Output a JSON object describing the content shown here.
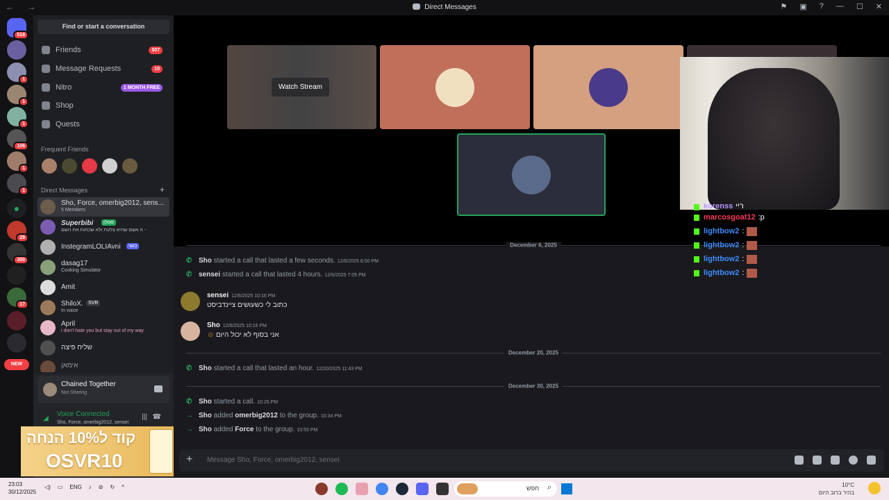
{
  "window": {
    "title": "Direct Messages"
  },
  "sidebar": {
    "find_placeholder": "Find or start a conversation",
    "nav": [
      {
        "label": "Friends",
        "badge": "507"
      },
      {
        "label": "Message Requests",
        "badge": "10"
      },
      {
        "label": "Nitro",
        "badge": "1 MONTH FREE"
      },
      {
        "label": "Shop"
      },
      {
        "label": "Quests"
      }
    ],
    "frequent_friends_label": "Frequent Friends",
    "dm_header": "Direct Messages",
    "dms": [
      {
        "name": "Sho, Force, omerbig2012, sens...",
        "sub": "5 Members"
      },
      {
        "name": "Superbibi",
        "tag": "סטלן",
        "sub": "ה אשם שהיא צלעת ולא שכחות את השם -"
      },
      {
        "name": "InstegramLOLIAvni",
        "tag": "כושי",
        "sub": ""
      },
      {
        "name": "dasag17",
        "sub": "Cooking Simulator"
      },
      {
        "name": "Amit",
        "sub": ""
      },
      {
        "name": "ShiloX.",
        "tag": "SVR",
        "sub": "In voice"
      },
      {
        "name": "April",
        "sub": "i don't hate you but stay out of my way"
      },
      {
        "name": "שליח פיצה",
        "sub": ""
      },
      {
        "name": "אימאן",
        "sub": ""
      }
    ],
    "activity": {
      "title": "Chained Together",
      "sub": "Not Sharing"
    },
    "voice": {
      "status": "Voice Connected",
      "channel": "Sho, Force, omerbig2012, sensei"
    },
    "promo": {
      "line1": "קוד ל10% הנחה",
      "line2": "OSVR10"
    }
  },
  "guild_badges": [
    "518",
    "1",
    "1",
    "1",
    "106",
    "1",
    "1",
    "29",
    "300",
    "17"
  ],
  "guild_new_label": "NEW",
  "stage": {
    "watch_stream": "Watch Stream"
  },
  "stream_chat": [
    {
      "user": "korenss",
      "text": "ריי",
      "color": "#b59bff"
    },
    {
      "user": "marcosgoat12",
      "text": "p",
      "color": "#ff3b5c"
    },
    {
      "user": "lightbow2",
      "text": "",
      "color": "#3f8cff"
    },
    {
      "user": "lightbow2",
      "text": "",
      "color": "#3f8cff"
    },
    {
      "user": "lightbow2",
      "text": "",
      "color": "#3f8cff"
    },
    {
      "user": "lightbow2",
      "text": "",
      "color": "#3f8cff"
    }
  ],
  "messages": {
    "top_date": "December 6, 2025",
    "sys1": {
      "user": "Sho",
      "text": "started a call that lasted a few seconds.",
      "time": "12/6/2025 6:50 PM"
    },
    "sys2": {
      "user": "sensei",
      "text": "started a call that lasted 4 hours.",
      "time": "12/6/2025 7:05 PM"
    },
    "m1": {
      "user": "sensei",
      "time": "12/6/2025 10:16 PM",
      "text": "כתוב לי כשעושים ציינדביסט"
    },
    "m2": {
      "user": "Sho",
      "time": "12/6/2025 10:16 PM",
      "text": "אני בסוף לא יכול היום"
    },
    "date2": "December 20, 2025",
    "sys3": {
      "user": "Sho",
      "text": "started a call that lasted an hour.",
      "time": "12/20/2025 11:43 PM"
    },
    "date3": "December 30, 2025",
    "sys4": {
      "user": "Sho",
      "text": "started a call.",
      "time": "10:25 PM"
    },
    "sys5": {
      "user": "Sho",
      "pre": "added",
      "target": "omerbig2012",
      "post": "to the group.",
      "time": "10:34 PM"
    },
    "sys6": {
      "user": "Sho",
      "pre": "added",
      "target": "Force",
      "post": "to the group.",
      "time": "10:55 PM"
    }
  },
  "composer": {
    "placeholder": "Message Sho, Force, omerbig2012, sensei"
  },
  "taskbar": {
    "time": "23:03",
    "date": "30/12/2025",
    "lang": "ENG",
    "search": "חפש",
    "temp": "10°C",
    "weather": "בהיר ברוב היום"
  }
}
